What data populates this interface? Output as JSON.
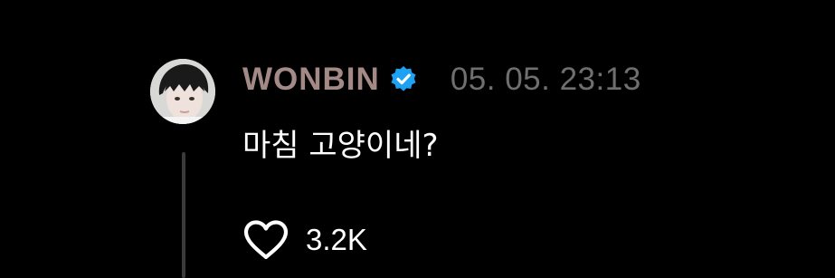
{
  "comment": {
    "author": {
      "username": "WONBIN",
      "verified": true,
      "avatar_icon": "profile-photo"
    },
    "timestamp": "05. 05. 23:13",
    "text": "마침 고양이네?",
    "likes": {
      "icon": "heart-outline-icon",
      "count": "3.2K"
    }
  },
  "colors": {
    "background": "#000000",
    "username": "#a48a86",
    "timestamp": "#6f6f6f",
    "text": "#ffffff",
    "verified_badge": "#1da1f2",
    "thread_line": "#3a3a3a"
  }
}
